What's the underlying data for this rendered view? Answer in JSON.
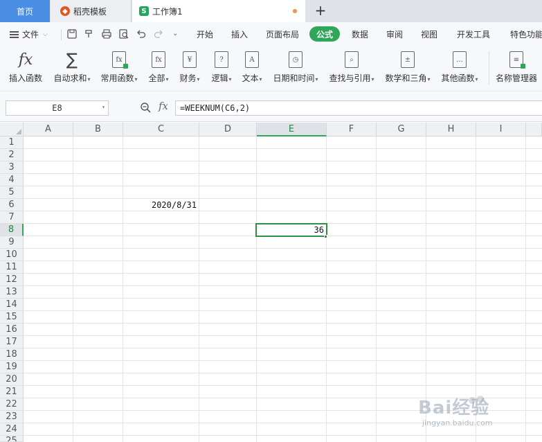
{
  "tabs": {
    "home": "首页",
    "doc": "稻壳模板",
    "workbook": "工作簿1",
    "add": "+"
  },
  "menu": {
    "file": "文件",
    "items": [
      "开始",
      "插入",
      "页面布局",
      "公式",
      "数据",
      "审阅",
      "视图",
      "开发工具",
      "特色功能"
    ],
    "active": "公式"
  },
  "ribbon": {
    "buttons": [
      {
        "label": "插入函数",
        "icon": "fx-icon",
        "caret": false
      },
      {
        "label": "自动求和",
        "icon": "sigma-icon",
        "caret": true
      },
      {
        "label": "常用函数",
        "icon": "common-function-icon",
        "caret": true
      },
      {
        "label": "全部",
        "icon": "all-functions-icon",
        "caret": true
      },
      {
        "label": "财务",
        "icon": "finance-icon",
        "caret": true
      },
      {
        "label": "逻辑",
        "icon": "logic-icon",
        "caret": true
      },
      {
        "label": "文本",
        "icon": "text-icon",
        "caret": true
      },
      {
        "label": "日期和时间",
        "icon": "datetime-icon",
        "caret": true
      },
      {
        "label": "查找与引用",
        "icon": "lookup-icon",
        "caret": true
      },
      {
        "label": "数学和三角",
        "icon": "math-icon",
        "caret": true
      },
      {
        "label": "其他函数",
        "icon": "other-functions-icon",
        "caret": true
      },
      {
        "label": "名称管理器",
        "icon": "name-manager-icon",
        "caret": false
      }
    ]
  },
  "formula_bar": {
    "name_box": "E8",
    "fx": "fx",
    "formula": "=WEEKNUM(C6,2)"
  },
  "sheet": {
    "columns": [
      "A",
      "B",
      "C",
      "D",
      "E",
      "F",
      "G",
      "H",
      "I"
    ],
    "active_column": "E",
    "rows": [
      "1",
      "2",
      "3",
      "4",
      "5",
      "6",
      "7",
      "8",
      "9",
      "10",
      "11",
      "12",
      "13",
      "14",
      "15",
      "16",
      "17",
      "18",
      "19",
      "20",
      "21",
      "22",
      "23",
      "24",
      "25"
    ],
    "active_row": "8",
    "cells": {
      "C6": "2020/8/31",
      "E8": "36"
    }
  },
  "watermark": {
    "text": "Bai经验",
    "sub": "jingyan.baidu.com"
  },
  "colors": {
    "accent": "#2fa65a",
    "home_tab": "#4a8ee6",
    "selection": "#2f8f46"
  }
}
